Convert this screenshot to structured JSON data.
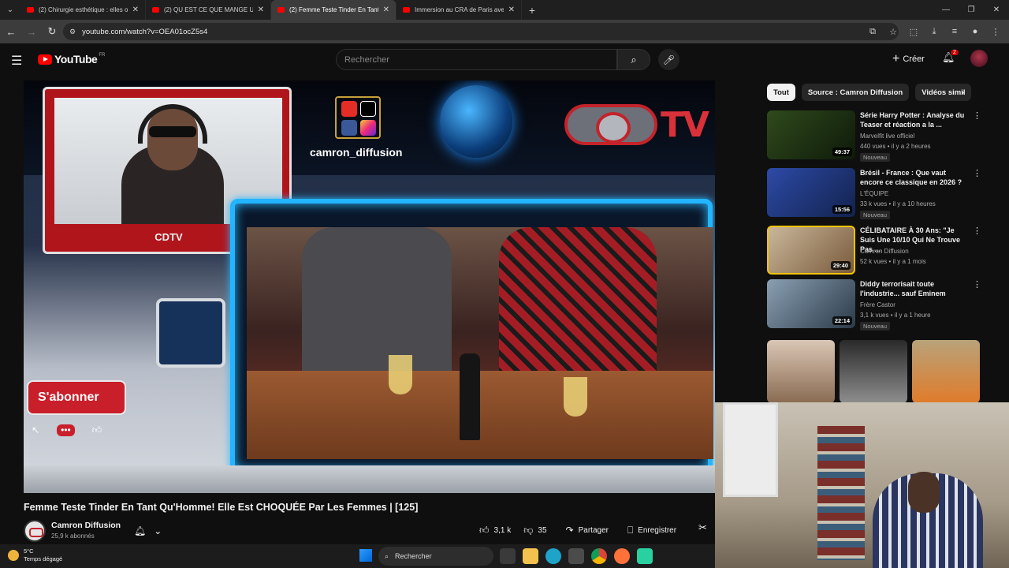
{
  "browser": {
    "tabs": [
      {
        "title": "(2) Chirurgie esthétique : elles o",
        "active": false
      },
      {
        "title": "(2) QU EST CE QUE MANGE UN",
        "active": false
      },
      {
        "title": "(2) Femme Teste Tinder En Tant",
        "active": true
      },
      {
        "title": "Immersion au CRA de Paris ave",
        "active": false
      }
    ],
    "url": "youtube.com/watch?v=OEA01ocZ5s4"
  },
  "youtube": {
    "logo_text": "YouTube",
    "country_code": "FR",
    "search_placeholder": "Rechercher",
    "create_label": "Créer",
    "notification_count": "2"
  },
  "player": {
    "channel_handle": "camron_diffusion",
    "tv_logo_text": "TV",
    "webcam_banner": "CDTV",
    "subscribe_overlay": "S'abonner"
  },
  "video": {
    "title": "Femme Teste Tinder En Tant Qu'Homme! Elle Est CHOQUÉE Par Les Femmes | [125]",
    "channel_name": "Camron Diffusion",
    "subscribers": "25,9 k abonnés",
    "likes": "3,1 k",
    "dislikes": "35",
    "share_label": "Partager",
    "save_label": "Enregistrer"
  },
  "sidebar": {
    "chips": [
      "Tout",
      "Source : Camron Diffusion",
      "Vidéos simil"
    ],
    "recommendations": [
      {
        "title": "Série Harry Potter : Analyse du Teaser et réaction a la ...",
        "channel": "Marvelfit live officiel",
        "meta": "440 vues • il y a 2 heures",
        "badge": "Nouveau",
        "duration": "49:37",
        "color_a": "#2f4a1c",
        "color_b": "#0e1a0a"
      },
      {
        "title": "Brésil - France : Que vaut encore ce classique en 2026 ?",
        "channel": "L'ÉQUIPE",
        "meta": "33 k vues • il y a 10 heures",
        "badge": "Nouveau",
        "duration": "15:56",
        "color_a": "#2d4aa6",
        "color_b": "#12224d"
      },
      {
        "title": "CÉLIBATAIRE À 30 Ans: \"Je Suis Une 10/10 Qui Ne Trouve Pas ...",
        "channel": "Camron Diffusion",
        "meta": "52 k vues • il y a 1 mois",
        "badge": "",
        "duration": "29:40",
        "color_a": "#c9b79a",
        "color_b": "#7a5a3c"
      },
      {
        "title": "Diddy terrorisait toute l'industrie... sauf Eminem",
        "channel": "Frère Castor",
        "meta": "3,1 k vues • il y a 1 heure",
        "badge": "Nouveau",
        "duration": "22:14",
        "color_a": "#8aa0b3",
        "color_b": "#2b3a48"
      }
    ]
  },
  "taskbar": {
    "temperature": "5°C",
    "weather_desc": "Temps dégagé",
    "search_label": "Rechercher"
  }
}
